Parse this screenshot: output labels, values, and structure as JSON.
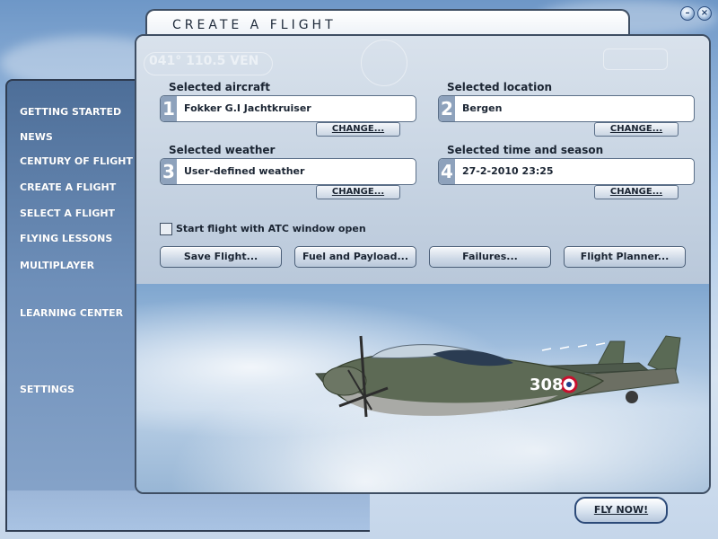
{
  "window": {
    "title": "CREATE A FLIGHT"
  },
  "nav": {
    "items": [
      "GETTING STARTED",
      "NEWS",
      "CENTURY OF FLIGHT",
      "CREATE A FLIGHT",
      "SELECT A FLIGHT",
      "FLYING LESSONS",
      "MULTIPLAYER",
      "LEARNING CENTER",
      "SETTINGS"
    ]
  },
  "sections": {
    "aircraft": {
      "label": "Selected aircraft",
      "number": "1",
      "value": "Fokker G.I Jachtkruiser",
      "change": "CHANGE..."
    },
    "location": {
      "label": "Selected location",
      "number": "2",
      "value": "Bergen",
      "change": "CHANGE..."
    },
    "weather": {
      "label": "Selected weather",
      "number": "3",
      "value": "User-defined weather",
      "change": "CHANGE..."
    },
    "time": {
      "label": "Selected time and season",
      "number": "4",
      "value": "27-2-2010 23:25",
      "change": "CHANGE..."
    }
  },
  "atc_checkbox": {
    "label": "Start flight with ATC window open",
    "checked": false
  },
  "actions": {
    "save": "Save Flight...",
    "fuel": "Fuel and Payload...",
    "failures": "Failures...",
    "planner": "Flight Planner..."
  },
  "aircraft_image": {
    "tail_code": "308"
  },
  "fly_now": "FLY NOW!",
  "bg_decor": {
    "heading": "041° 110.5 VEN"
  },
  "icons": {
    "minimize": "minimize-icon",
    "close": "close-icon"
  },
  "colors": {
    "panel_border": "#3e4e63",
    "nav_bg": "#5a7aa4",
    "text": "#1b2533"
  }
}
